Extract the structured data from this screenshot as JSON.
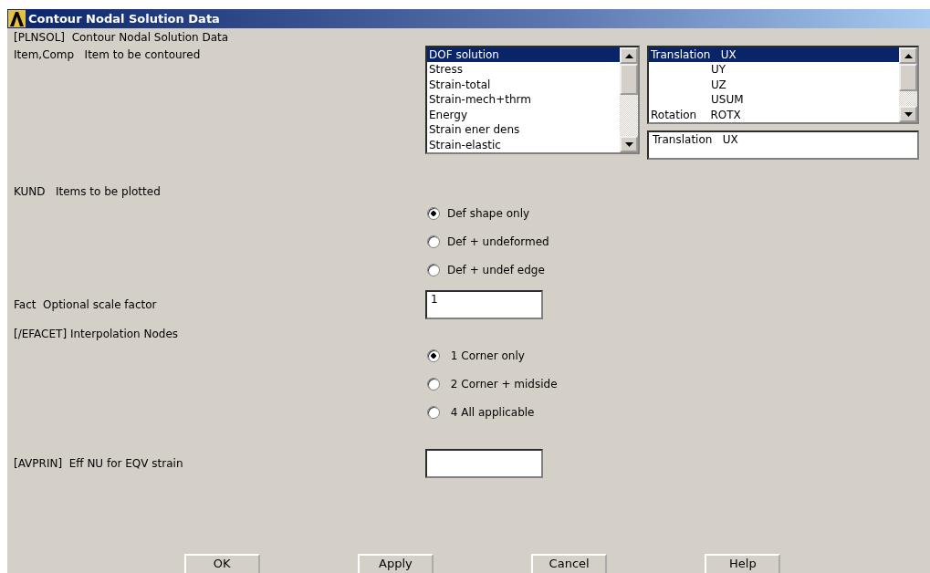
{
  "window": {
    "title": "Contour Nodal Solution Data"
  },
  "command_label": "[PLNSOL]  Contour Nodal Solution Data",
  "item_comp": {
    "label": "Item,Comp   Item to be contoured",
    "items": [
      {
        "label": "DOF solution",
        "selected": true
      },
      {
        "label": "Stress",
        "selected": false
      },
      {
        "label": "Strain-total",
        "selected": false
      },
      {
        "label": "Strain-mech+thrm",
        "selected": false
      },
      {
        "label": "Energy",
        "selected": false
      },
      {
        "label": "Strain ener dens",
        "selected": false
      },
      {
        "label": "Strain-elastic",
        "selected": false
      }
    ],
    "components": [
      {
        "label": "Translation   UX",
        "kind": "group",
        "selected": true
      },
      {
        "label": "UY",
        "kind": "component",
        "selected": false
      },
      {
        "label": "UZ",
        "kind": "component",
        "selected": false
      },
      {
        "label": "USUM",
        "kind": "component",
        "selected": false
      },
      {
        "label": "Rotation    ROTX",
        "kind": "group",
        "selected": false
      }
    ],
    "component_value": "Translation   UX"
  },
  "kund": {
    "label": "KUND   Items to be plotted",
    "options": [
      {
        "label": "Def shape only",
        "selected": true
      },
      {
        "label": "Def + undeformed",
        "selected": false
      },
      {
        "label": "Def + undef edge",
        "selected": false
      }
    ]
  },
  "fact": {
    "label": "Fact  Optional scale factor",
    "value": "1"
  },
  "efacet": {
    "label": "[/EFACET] Interpolation Nodes",
    "options": [
      {
        "label": " 1 Corner only",
        "selected": true
      },
      {
        "label": " 2 Corner + midside",
        "selected": false
      },
      {
        "label": " 4 All applicable",
        "selected": false
      }
    ]
  },
  "avprin": {
    "label": "[AVPRIN]  Eff NU for EQV strain"
  },
  "buttons": [
    "OK",
    "Apply",
    "Cancel",
    "Help"
  ]
}
